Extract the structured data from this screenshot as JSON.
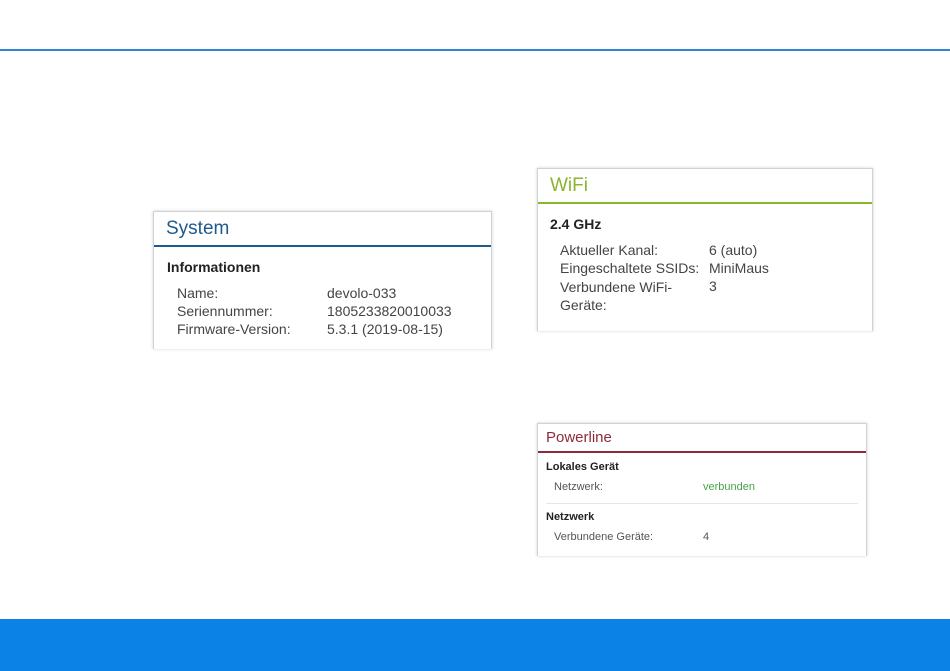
{
  "system": {
    "title": "System",
    "section": "Informationen",
    "rows": [
      {
        "label": "Name:",
        "value": "devolo-033"
      },
      {
        "label": "Seriennummer:",
        "value": "1805233820010033"
      },
      {
        "label": "Firmware-Version:",
        "value": "5.3.1 (2019-08-15)"
      }
    ]
  },
  "wifi": {
    "title": "WiFi",
    "section": "2.4 GHz",
    "rows": [
      {
        "label": "Aktueller Kanal:",
        "value": "6 (auto)"
      },
      {
        "label": "Eingeschaltete SSIDs:",
        "value": "MiniMaus"
      },
      {
        "label": "Verbundene WiFi-Geräte:",
        "value": "3"
      }
    ]
  },
  "powerline": {
    "title": "Powerline",
    "local_section": "Lokales Gerät",
    "local_rows": [
      {
        "label": "Netzwerk:",
        "value": "verbunden"
      }
    ],
    "network_section": "Netzwerk",
    "network_rows": [
      {
        "label": "Verbundene Geräte:",
        "value": "4"
      }
    ]
  },
  "colors": {
    "top_rule": "#2d87d4",
    "bottom_band": "#0a82e6",
    "system_accent": "#1f5a8c",
    "wifi_accent": "#8ab52e",
    "powerline_accent": "#8e2b3a",
    "status_ok": "#4aa24a"
  }
}
